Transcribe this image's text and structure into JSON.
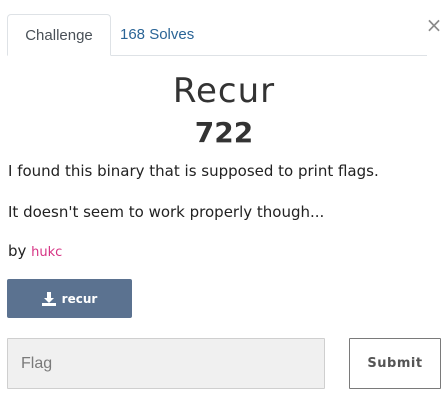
{
  "modal": {
    "close_glyph": "×"
  },
  "tabs": [
    {
      "label": "Challenge",
      "active": true
    },
    {
      "label": "168 Solves",
      "active": false
    }
  ],
  "challenge": {
    "title": "Recur",
    "points": "722",
    "description": [
      "I found this binary that is supposed to print flags.",
      "It doesn't seem to work properly though..."
    ],
    "author_prefix": "by ",
    "author": "hukc",
    "download_label": "recur",
    "download_icon": "download-icon"
  },
  "submission": {
    "placeholder": "Flag",
    "value": "",
    "submit_label": "Submit"
  },
  "colors": {
    "download_button": "#5b7290",
    "tab_link": "#2a6496",
    "author_link": "#d63384"
  }
}
